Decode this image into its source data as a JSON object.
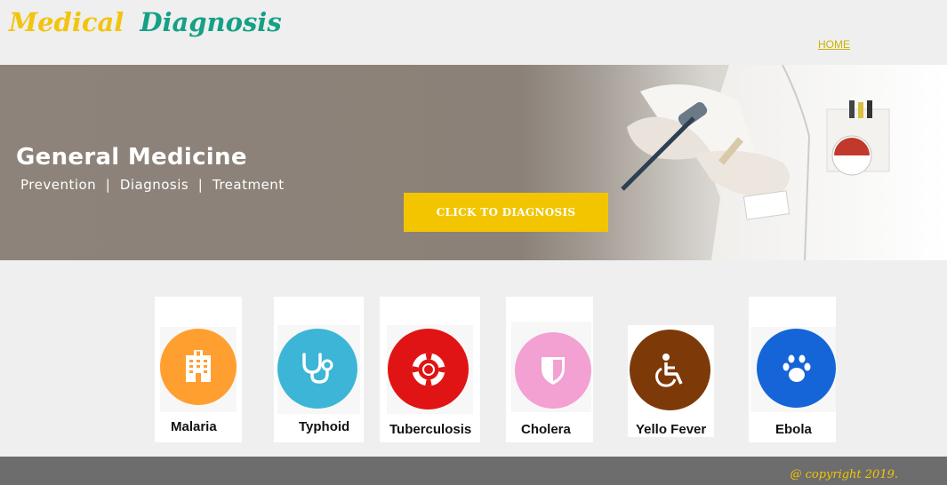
{
  "brand": {
    "word1": "Medical",
    "word2": "Diagnosis"
  },
  "nav": {
    "home": "HOME"
  },
  "hero": {
    "title": "General Medicine",
    "subtitle": "Prevention  |  Diagnosis  |  Treatment",
    "cta_label": "CLICK TO DIAGNOSIS"
  },
  "diseases": [
    {
      "label": "Malaria",
      "icon": "hospital-icon",
      "color": "#ff9f2f"
    },
    {
      "label": "Typhoid",
      "icon": "stethoscope-icon",
      "color": "#3db5d6"
    },
    {
      "label": "Tuberculosis",
      "icon": "lifebuoy-icon",
      "color": "#e01414"
    },
    {
      "label": "Cholera",
      "icon": "shield-icon",
      "color": "#f3a0d2"
    },
    {
      "label": "Yello Fever",
      "icon": "wheelchair-icon",
      "color": "#7d3a08"
    },
    {
      "label": "Ebola",
      "icon": "paw-icon",
      "color": "#1565d8"
    }
  ],
  "footer": {
    "copyright": "@ copyright 2019."
  },
  "colors": {
    "accent_yellow": "#f2c500",
    "brand_green": "#16a085",
    "footer_gray": "#6d6d6d"
  }
}
